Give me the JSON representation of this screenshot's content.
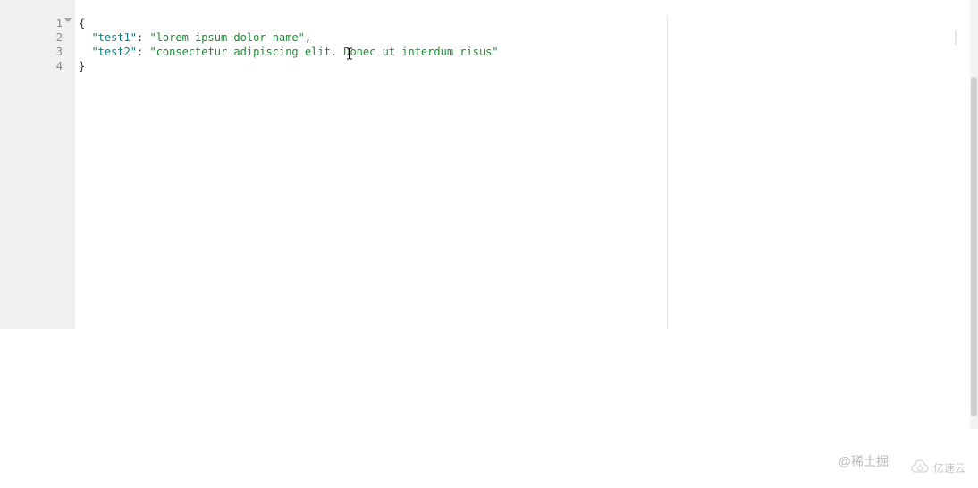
{
  "editor": {
    "lines": [
      {
        "num": "1",
        "fold": true,
        "selected": false,
        "segments": [
          {
            "cls": "punct",
            "text": "{"
          }
        ]
      },
      {
        "num": "2",
        "fold": false,
        "selected": true,
        "segments": [
          {
            "cls": "punct",
            "text": "  "
          },
          {
            "cls": "key",
            "text": "\"test1\""
          },
          {
            "cls": "punct",
            "text": ": "
          },
          {
            "cls": "string",
            "text": "\"lorem ipsum dolor name\""
          },
          {
            "cls": "punct",
            "text": ","
          }
        ]
      },
      {
        "num": "3",
        "fold": false,
        "selected": false,
        "segments": [
          {
            "cls": "punct",
            "text": "  "
          },
          {
            "cls": "key",
            "text": "\"test2\""
          },
          {
            "cls": "punct",
            "text": ": "
          },
          {
            "cls": "string",
            "text": "\"consectetur adipiscing elit. Donec ut interdum risus\""
          }
        ]
      },
      {
        "num": "4",
        "fold": false,
        "selected": false,
        "segments": [
          {
            "cls": "punct",
            "text": "}"
          }
        ]
      }
    ]
  },
  "watermarks": {
    "left": "@稀土掘",
    "right": "亿速云"
  }
}
